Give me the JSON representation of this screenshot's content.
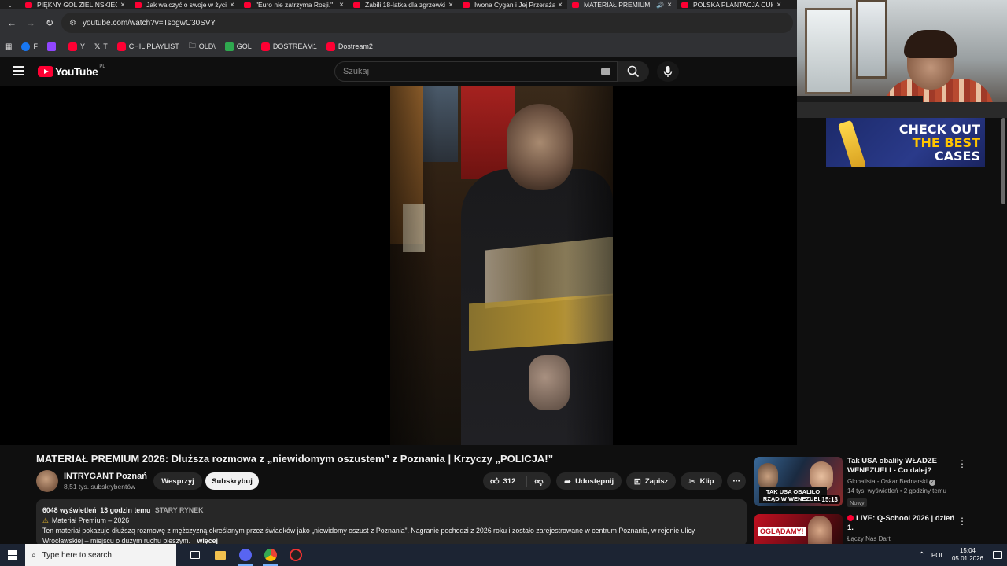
{
  "browser": {
    "tabs": [
      {
        "title": "PIĘKNY GOL ZIELIŃSKIEGO",
        "active": false
      },
      {
        "title": "Jak walczyć o swoje w życiu",
        "active": false
      },
      {
        "title": "\"Euro nie zatrzyma Rosji.\"",
        "active": false
      },
      {
        "title": "Zabili 18-latka dla zgrzewki",
        "active": false
      },
      {
        "title": "Iwona Cygan i Jej Przerażające",
        "active": false
      },
      {
        "title": "MATERIAŁ PREMIUM",
        "active": true
      },
      {
        "title": "POLSKA PLANTACJA CUKRU",
        "active": false
      }
    ],
    "url": "youtube.com/watch?v=TsogwC30SVY",
    "bookmarks": [
      {
        "label": "F",
        "color": "#1877f2"
      },
      {
        "label": "",
        "color": "#9146ff"
      },
      {
        "label": "Y",
        "color": "#ff0033"
      },
      {
        "label": "T",
        "color": "#000000"
      },
      {
        "label": "CHIL PLAYLIST",
        "color": "#ff0033"
      },
      {
        "label": "OLD\\",
        "color": "folder"
      },
      {
        "label": "GOL",
        "color": "#2fa84f"
      },
      {
        "label": "DOSTREAM1",
        "color": "#ff0033"
      },
      {
        "label": "Dostream2",
        "color": "#ff0033"
      }
    ]
  },
  "youtube": {
    "logo_text": "YouTube",
    "country": "PL",
    "search_placeholder": "Szukaj"
  },
  "overlay": {
    "ad_line1": "CHECK OUT",
    "ad_line2": "THE BEST",
    "ad_line3": "CASES"
  },
  "video": {
    "title": "MATERIAŁ PREMIUM 2026: Dłuższa rozmowa z „niewidomym oszustem” z Poznania | Krzyczy „POLICJA!”",
    "channel": "INTRYGANT Poznań",
    "subscribers": "8,51 tys. subskrybentów",
    "support_label": "Wesprzyj",
    "subscribe_label": "Subskrybuj",
    "likes": "312",
    "share_label": "Udostępnij",
    "save_label": "Zapisz",
    "clip_label": "Klip",
    "views": "6048 wyświetleń",
    "age": "13 godzin temu",
    "tag": "STARY RYNEK",
    "desc_heading": "Materiał Premium – 2026",
    "desc_text": "Ten materiał pokazuje dłuższą rozmowę z mężczyzną określanym przez świadków jako „niewidomy oszust z Poznania”. Nagranie pochodzi z 2026 roku i zostało zarejestrowane w centrum Poznania, w rejonie ulicy",
    "desc_text2": "Wrocławskiej – miejscu o dużym ruchu pieszym.",
    "more_label": "więcej"
  },
  "recommendations": [
    {
      "title": "Tak USA obaliły WŁADZE WENEZUELI - Co dalej?",
      "channel": "Globalista - Oskar Bednarski",
      "meta": "14 tys. wyświetleń • 2 godziny temu",
      "badge": "Nowy",
      "duration": "15:13",
      "thumb_caption": "TAK USA OBALIŁO RZĄD W WENEZUELI"
    },
    {
      "title": "LIVE: Q-School 2026 | dzień 1.",
      "channel": "Łączy Nas Dart",
      "meta": "",
      "badge": "",
      "duration": "",
      "thumb_caption": "OGLĄDAMY!"
    }
  ],
  "taskbar": {
    "search_placeholder": "Type here to search",
    "lang": "POL",
    "time": "15:04",
    "date": "05.01.2026"
  }
}
